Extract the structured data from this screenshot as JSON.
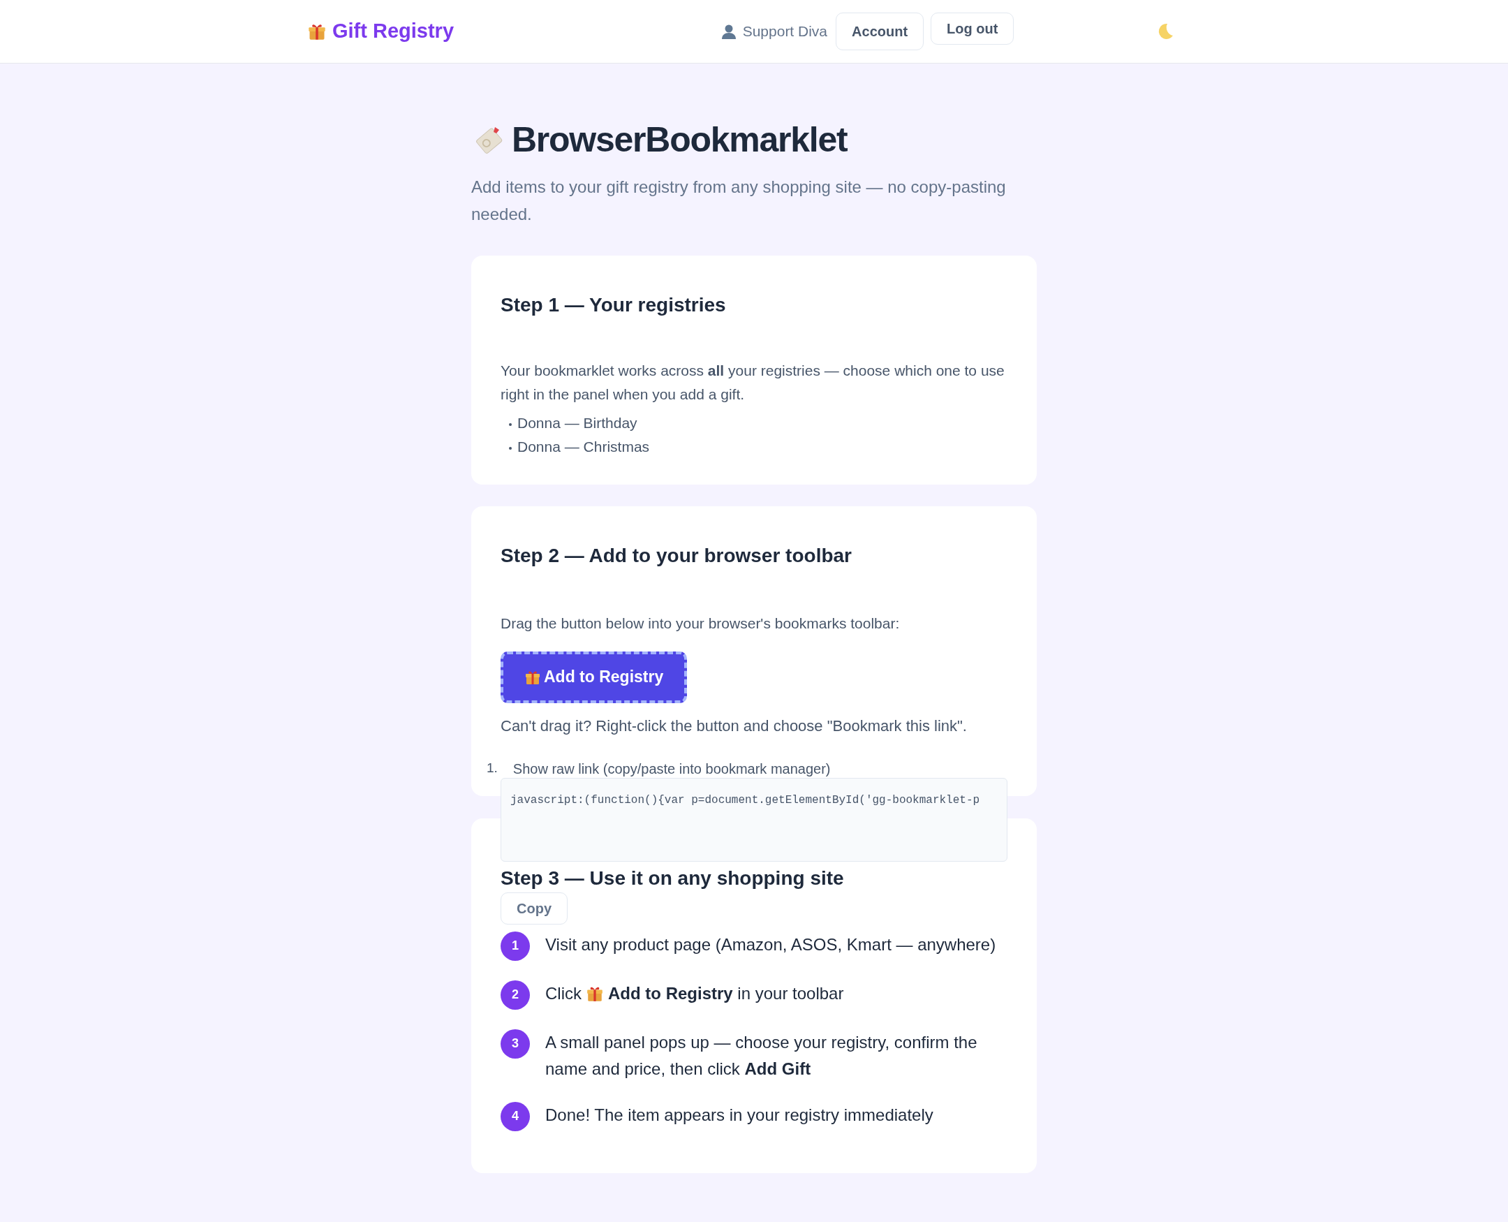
{
  "header": {
    "logo": "Gift Registry",
    "user": "Support Diva",
    "buttons": [
      "Account",
      "Log out"
    ]
  },
  "page": {
    "title": "BrowserBookmarklet",
    "subtitle": "Add items to your gift registry from any shopping site — no copy-pasting needed."
  },
  "step1": {
    "heading": "Step 1 — Your registries",
    "text": "Your bookmarklet works across **all** your registries — choose which one to use right in the panel when you add a gift.",
    "registries": [
      "Donna — Birthday",
      "Donna — Christmas"
    ]
  },
  "step2": {
    "heading": "Step 2 — Add to your browser toolbar",
    "text": "Drag the button below into your browser's bookmarks toolbar:",
    "bookmarklet_button": "Add to Registry",
    "hint": "Can't drag it? Right-click the button and choose \"Bookmark this link\".",
    "raw_link": {
      "marker": "1.",
      "label": "Show raw link (copy/paste into bookmark manager)",
      "code": "javascript:(function(){var p=document.getElementById('gg-bookmarklet-p",
      "copy_button": "Copy"
    }
  },
  "step3": {
    "heading": "Step 3 — Use it on any shopping site",
    "steps": [
      {
        "number": "1",
        "kind": "plain",
        "text": "Visit any product page (Amazon, ASOS, Kmart — anywhere)"
      },
      {
        "number": "2",
        "kind": "with-icon",
        "before": "Click",
        "text": "**Add to Registry** in your toolbar"
      },
      {
        "number": "3",
        "kind": "plain",
        "text": "A small panel pops up — choose your registry, confirm the name and price, then click **Add Gift**"
      },
      {
        "number": "4",
        "kind": "plain",
        "text": "Done! The item appears in your registry immediately"
      }
    ]
  }
}
